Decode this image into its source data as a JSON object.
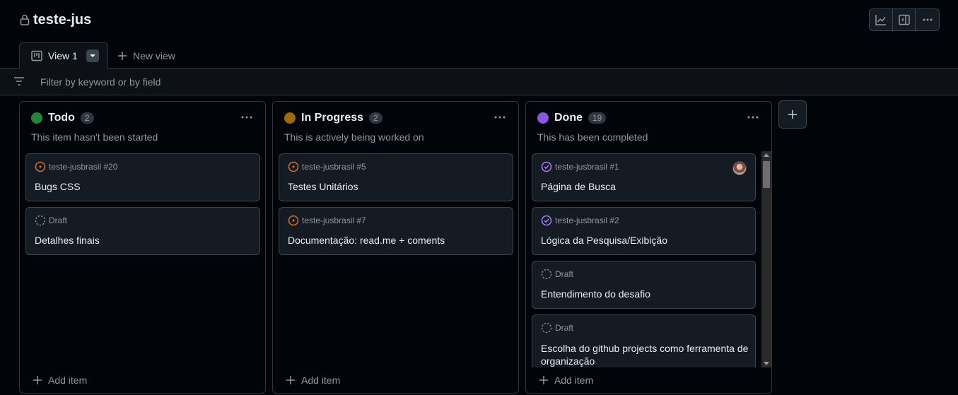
{
  "project": {
    "title": "teste-jus"
  },
  "top_actions": [
    {
      "icon": "chart-icon"
    },
    {
      "icon": "side-panel-icon"
    },
    {
      "icon": "kebab-icon"
    }
  ],
  "tabs": {
    "active_label": "View 1",
    "new_view_label": "New view"
  },
  "filter": {
    "placeholder": "Filter by keyword or by field"
  },
  "columns": [
    {
      "title": "Todo",
      "count": "2",
      "color": "#238636",
      "description": "This item hasn't been started",
      "add_label": "Add item",
      "cards": [
        {
          "status": "open",
          "meta": "teste-jusbrasil #20",
          "title": "Bugs CSS"
        },
        {
          "status": "draft",
          "meta": "Draft",
          "title": "Detalhes finais"
        }
      ]
    },
    {
      "title": "In Progress",
      "count": "2",
      "color": "#9e6a03",
      "description": "This is actively being worked on",
      "add_label": "Add item",
      "cards": [
        {
          "status": "open",
          "meta": "teste-jusbrasil #5",
          "title": "Testes Unitários"
        },
        {
          "status": "open",
          "meta": "teste-jusbrasil #7",
          "title": "Documentação: read.me + coments"
        }
      ]
    },
    {
      "title": "Done",
      "count": "19",
      "color": "#8957e5",
      "description": "This has been completed",
      "add_label": "Add item",
      "cards": [
        {
          "status": "done",
          "meta": "teste-jusbrasil #1",
          "title": "Página de Busca"
        },
        {
          "status": "done",
          "meta": "teste-jusbrasil #2",
          "title": "Lógica da Pesquisa/Exibição"
        },
        {
          "status": "draft",
          "meta": "Draft",
          "title": "Entendimento do desafio"
        },
        {
          "status": "draft",
          "meta": "Draft",
          "title": "Escolha do github projects como ferramenta de organização"
        }
      ]
    }
  ]
}
